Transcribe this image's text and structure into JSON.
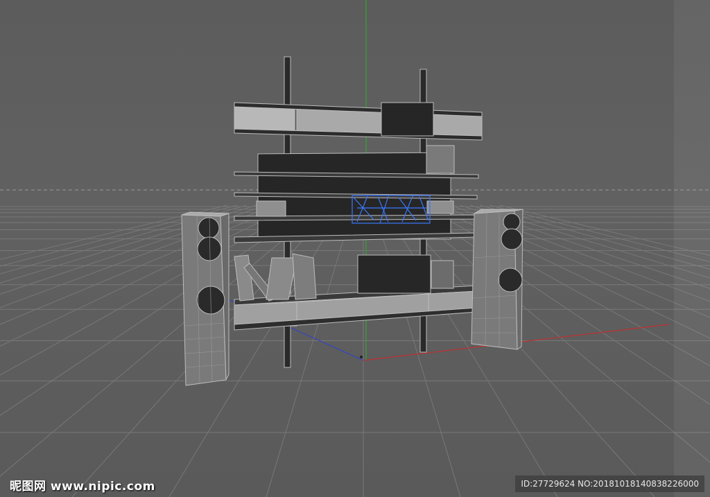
{
  "viewport": {
    "background_color": "#5e5e5e",
    "grid_color": "#787878",
    "horizon_line_color": "#9a9a9a",
    "axis_x_color": "#c03030",
    "axis_y_color": "#30b030",
    "axis_z_color": "#3040c0",
    "selection_color": "#3a78ff",
    "model_fill_color": "#2a2a2a",
    "model_edge_color": "#bdbdbd"
  },
  "watermark": {
    "site_text": "昵图网 www.nipic.com",
    "id_text": "ID:27729624 NO:20181018140838226000"
  }
}
